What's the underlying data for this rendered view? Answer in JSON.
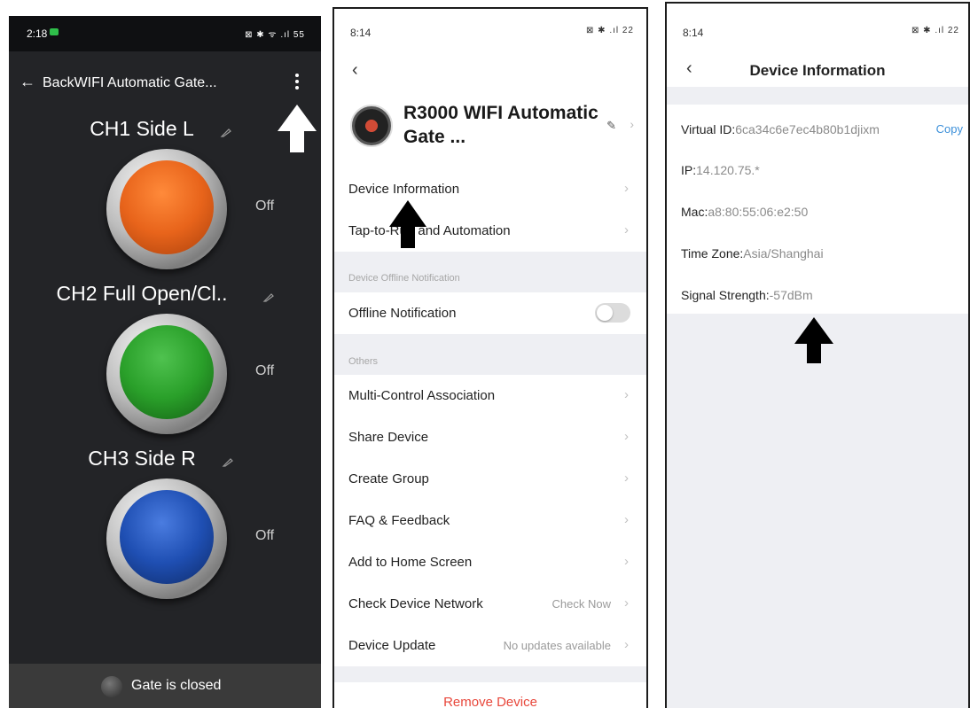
{
  "panel1": {
    "status_time": "2:18",
    "status_icons": "⊠ ✱ ᯤ .ıl 55",
    "back_label": "Back",
    "title": "WIFI Automatic Gate...",
    "channels": [
      {
        "label": "CH1 Side L",
        "state": "Off",
        "color": "#e8641b"
      },
      {
        "label": "CH2 Full Open/Cl..",
        "state": "Off",
        "color": "#2aa02a"
      },
      {
        "label": "CH3 Side R",
        "state": "Off",
        "color": "#1f4fb3"
      }
    ],
    "gate_status": "Gate is closed"
  },
  "panel2": {
    "status_time": "8:14",
    "status_icons": "⊠ ✱ .ıl 22",
    "device_name": "R3000 WIFI Automatic Gate ...",
    "rows": {
      "device_info": "Device Information",
      "tap_to_run": "Tap-to-Run and Automation",
      "offline_section": "Device Offline Notification",
      "offline_notification": "Offline Notification",
      "others_section": "Others",
      "multi_control": "Multi-Control Association",
      "share_device": "Share Device",
      "create_group": "Create Group",
      "faq": "FAQ & Feedback",
      "add_home": "Add to Home Screen",
      "check_network": "Check Device Network",
      "check_network_value": "Check Now",
      "device_update": "Device Update",
      "device_update_value": "No updates available"
    },
    "offline_toggle_on": false,
    "remove_device": "Remove Device"
  },
  "panel3": {
    "status_time": "8:14",
    "status_icons": "⊠ ✱ .ıl 22",
    "title": "Device Information",
    "virtual_id_key": "Virtual ID:",
    "virtual_id": "6ca34c6e7ec4b80b1djixm",
    "copy_label": "Copy",
    "ip_key": "IP:",
    "ip": "14.120.75.*",
    "mac_key": "Mac:",
    "mac": "a8:80:55:06:e2:50",
    "timezone_key": "Time Zone:",
    "timezone": "Asia/Shanghai",
    "signal_key": "Signal Strength:",
    "signal": "-57dBm"
  }
}
